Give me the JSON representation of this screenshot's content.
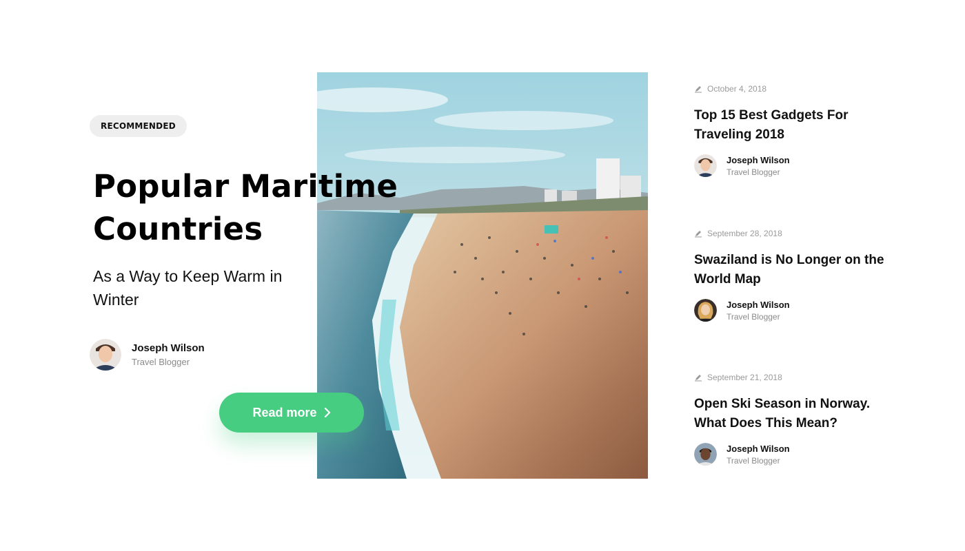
{
  "featured": {
    "badge": "RECOMMENDED",
    "title": "Popular Maritime Countries",
    "subtitle": "As a Way to Keep Warm in Winter",
    "author": {
      "name": "Joseph Wilson",
      "role": "Travel Blogger"
    },
    "cta": "Read more"
  },
  "articles": [
    {
      "date": "October 4, 2018",
      "title": "Top 15 Best Gadgets For Traveling 2018",
      "author": {
        "name": "Joseph Wilson",
        "role": "Travel Blogger"
      }
    },
    {
      "date": "September 28, 2018",
      "title": "Swaziland is No Longer on the World Map",
      "author": {
        "name": "Joseph Wilson",
        "role": "Travel Blogger"
      }
    },
    {
      "date": "September 21, 2018",
      "title": "Open Ski Season in Norway. What Does This Mean?",
      "author": {
        "name": "Joseph Wilson",
        "role": "Travel Blogger"
      }
    }
  ],
  "colors": {
    "accent": "#47cd82",
    "badge_bg": "#eeeeee",
    "muted_text": "#8a8a8a"
  },
  "icons": {
    "date": "pen-icon",
    "cta": "chevron-right-icon"
  }
}
